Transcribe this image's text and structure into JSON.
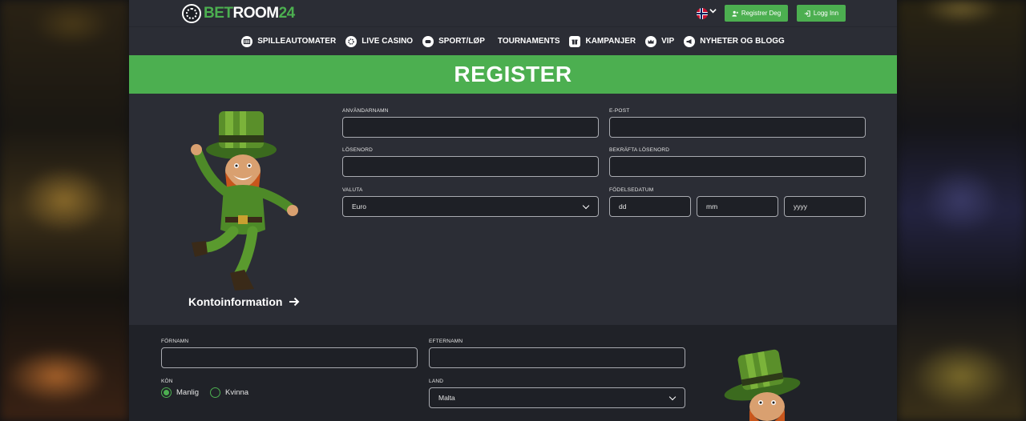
{
  "header": {
    "logo_main": "BET",
    "logo_room": "ROOM",
    "logo_num": "24",
    "language": "Norwegian",
    "register_label": "Registrer Deg",
    "login_label": "Logg Inn"
  },
  "nav": {
    "items": [
      {
        "label": "SPILLEAUTOMATER",
        "icon": "slot-icon"
      },
      {
        "label": "LIVE CASINO",
        "icon": "chip-icon"
      },
      {
        "label": "SPORT/LØP",
        "icon": "controller-icon"
      },
      {
        "label": "TOURNAMENTS",
        "icon": ""
      },
      {
        "label": "KAMPANJER",
        "icon": "gift-icon"
      },
      {
        "label": "VIP",
        "icon": "crown-icon"
      },
      {
        "label": "NYHETER OG BLOGG",
        "icon": "megaphone-icon"
      }
    ]
  },
  "banner": {
    "title": "REGISTER"
  },
  "account": {
    "section_label": "Kontoinformation",
    "username": {
      "label": "ANVÄNDARNAMN",
      "value": ""
    },
    "email": {
      "label": "E-POST",
      "value": ""
    },
    "password": {
      "label": "LÖSENORD",
      "value": ""
    },
    "password_confirm": {
      "label": "BEKRÄFTA LÖSENORD",
      "value": ""
    },
    "currency": {
      "label": "VALUTA",
      "value": "Euro"
    },
    "birthdate": {
      "label": "FÖDELSEDATUM",
      "day_placeholder": "dd",
      "month_placeholder": "mm",
      "year_placeholder": "yyyy"
    }
  },
  "personal": {
    "firstname": {
      "label": "FÖRNAMN",
      "value": ""
    },
    "lastname": {
      "label": "EFTERNAMN",
      "value": ""
    },
    "gender": {
      "label": "KÖN",
      "male": "Manlig",
      "female": "Kvinna",
      "selected": "male"
    },
    "country": {
      "label": "LAND",
      "value": "Malta"
    }
  },
  "colors": {
    "accent": "#4caf50",
    "panel": "#2b2d35",
    "panel_dark": "#202228"
  }
}
